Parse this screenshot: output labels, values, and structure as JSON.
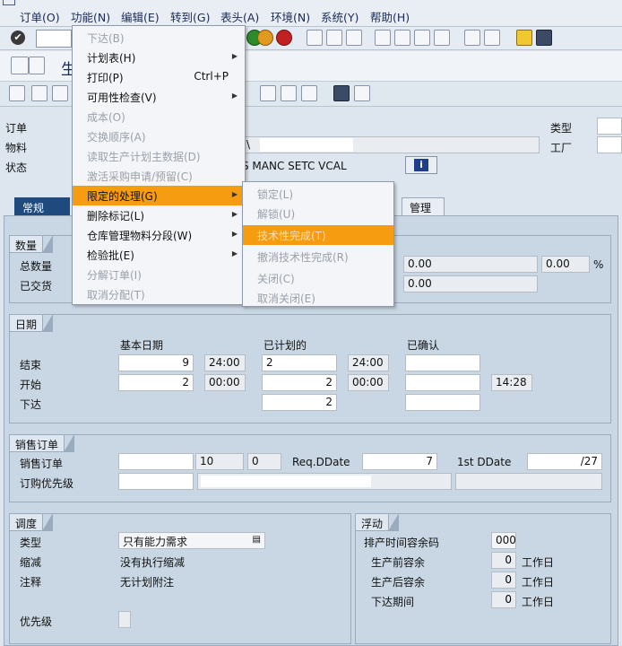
{
  "menubar": {
    "items": [
      "订单(O)",
      "功能(N)",
      "编辑(E)",
      "转到(G)",
      "表头(A)",
      "环境(N)",
      "系统(Y)",
      "帮助(H)"
    ]
  },
  "title": {
    "partial": "生"
  },
  "header": {
    "order_label": "订单",
    "material_label": "物料",
    "status_label": "状态",
    "status_value": "S MANC SETC VCAL",
    "material_sep": "\\",
    "type_label": "类型",
    "plant_label": "工厂"
  },
  "tabs": {
    "general": "常规",
    "admin": "管理"
  },
  "quantities": {
    "title": "数量",
    "total_label": "总数量",
    "delivered_label": "已交货",
    "scrap_qty": "0.00",
    "scrap_pct": "0.00",
    "pct_sign": "%",
    "second_value": "0.00"
  },
  "dates": {
    "title": "日期",
    "col_basic": "基本日期",
    "col_scheduled": "已计划的",
    "col_confirmed": "已确认",
    "end_label": "结束",
    "start_label": "开始",
    "release_label": "下达",
    "basic_end_time": "24:00",
    "basic_start_time": "00:00",
    "sched_end_time": "24:00",
    "sched_start_time": "00:00",
    "confirmed_start_time": "14:28",
    "basic_end_date_tail": "9",
    "basic_start_date_tail": "2",
    "sched_end_date_head": "2",
    "sched_start_date_tail": "2",
    "sched_release_partial": "2",
    "confirmed_release_partial": ""
  },
  "sales": {
    "title": "销售订单",
    "sales_order_label": "销售订单",
    "item": "10",
    "sched_line": "0",
    "req_ddate_label": "Req.DDate",
    "req_ddate_tail": "7",
    "first_ddate_label": "1st DDate",
    "first_ddate_tail": "/27",
    "priority_label": "订购优先级"
  },
  "scheduling": {
    "title": "调度",
    "type_label": "类型",
    "type_value": "只有能力需求",
    "reduction_label": "缩减",
    "reduction_value": "没有执行缩减",
    "note_label": "注释",
    "note_value": "无计划附注",
    "priority_label": "优先级"
  },
  "float": {
    "title": "浮动",
    "key_label": "排产时间容余码",
    "key_value": "000",
    "before_label": "生产前容余",
    "before_value": "0",
    "after_label": "生产后容余",
    "after_value": "0",
    "release_label": "下达期间",
    "release_value": "0",
    "unit": "工作日"
  },
  "function_menu": [
    {
      "label": "下达(B)",
      "enabled": false
    },
    {
      "label": "计划表(H)",
      "enabled": true,
      "submenu": true
    },
    {
      "label": "打印(P)",
      "enabled": true,
      "shortcut": "Ctrl+P"
    },
    {
      "label": "可用性检查(V)",
      "enabled": true,
      "submenu": true
    },
    {
      "label": "成本(O)",
      "enabled": false
    },
    {
      "label": "交换顺序(A)",
      "enabled": false
    },
    {
      "label": "读取生产计划主数据(D)",
      "enabled": false
    },
    {
      "label": "激活采购申请/预留(C)",
      "enabled": false
    },
    {
      "label": "限定的处理(G)",
      "enabled": true,
      "submenu": true,
      "highlighted": true
    },
    {
      "label": "删除标记(L)",
      "enabled": true,
      "submenu": true
    },
    {
      "label": "仓库管理物料分段(W)",
      "enabled": true,
      "submenu": true
    },
    {
      "label": "检验批(E)",
      "enabled": true,
      "submenu": true
    },
    {
      "label": "分解订单(I)",
      "enabled": false
    },
    {
      "label": "取消分配(T)",
      "enabled": false
    }
  ],
  "sub_menu": [
    {
      "label": "锁定(L)",
      "enabled": false
    },
    {
      "label": "解锁(U)",
      "enabled": false
    },
    {
      "label": "技术性完成(T)",
      "enabled": false,
      "highlighted": true
    },
    {
      "label": "撤消技术性完成(R)",
      "enabled": false
    },
    {
      "label": "关闭(C)",
      "enabled": false
    },
    {
      "label": "取消关闭(E)",
      "enabled": false
    }
  ],
  "colors": {
    "highlight": "#f59c10",
    "active_tab": "#1e4a7e",
    "panel": "#c9d7e4"
  }
}
